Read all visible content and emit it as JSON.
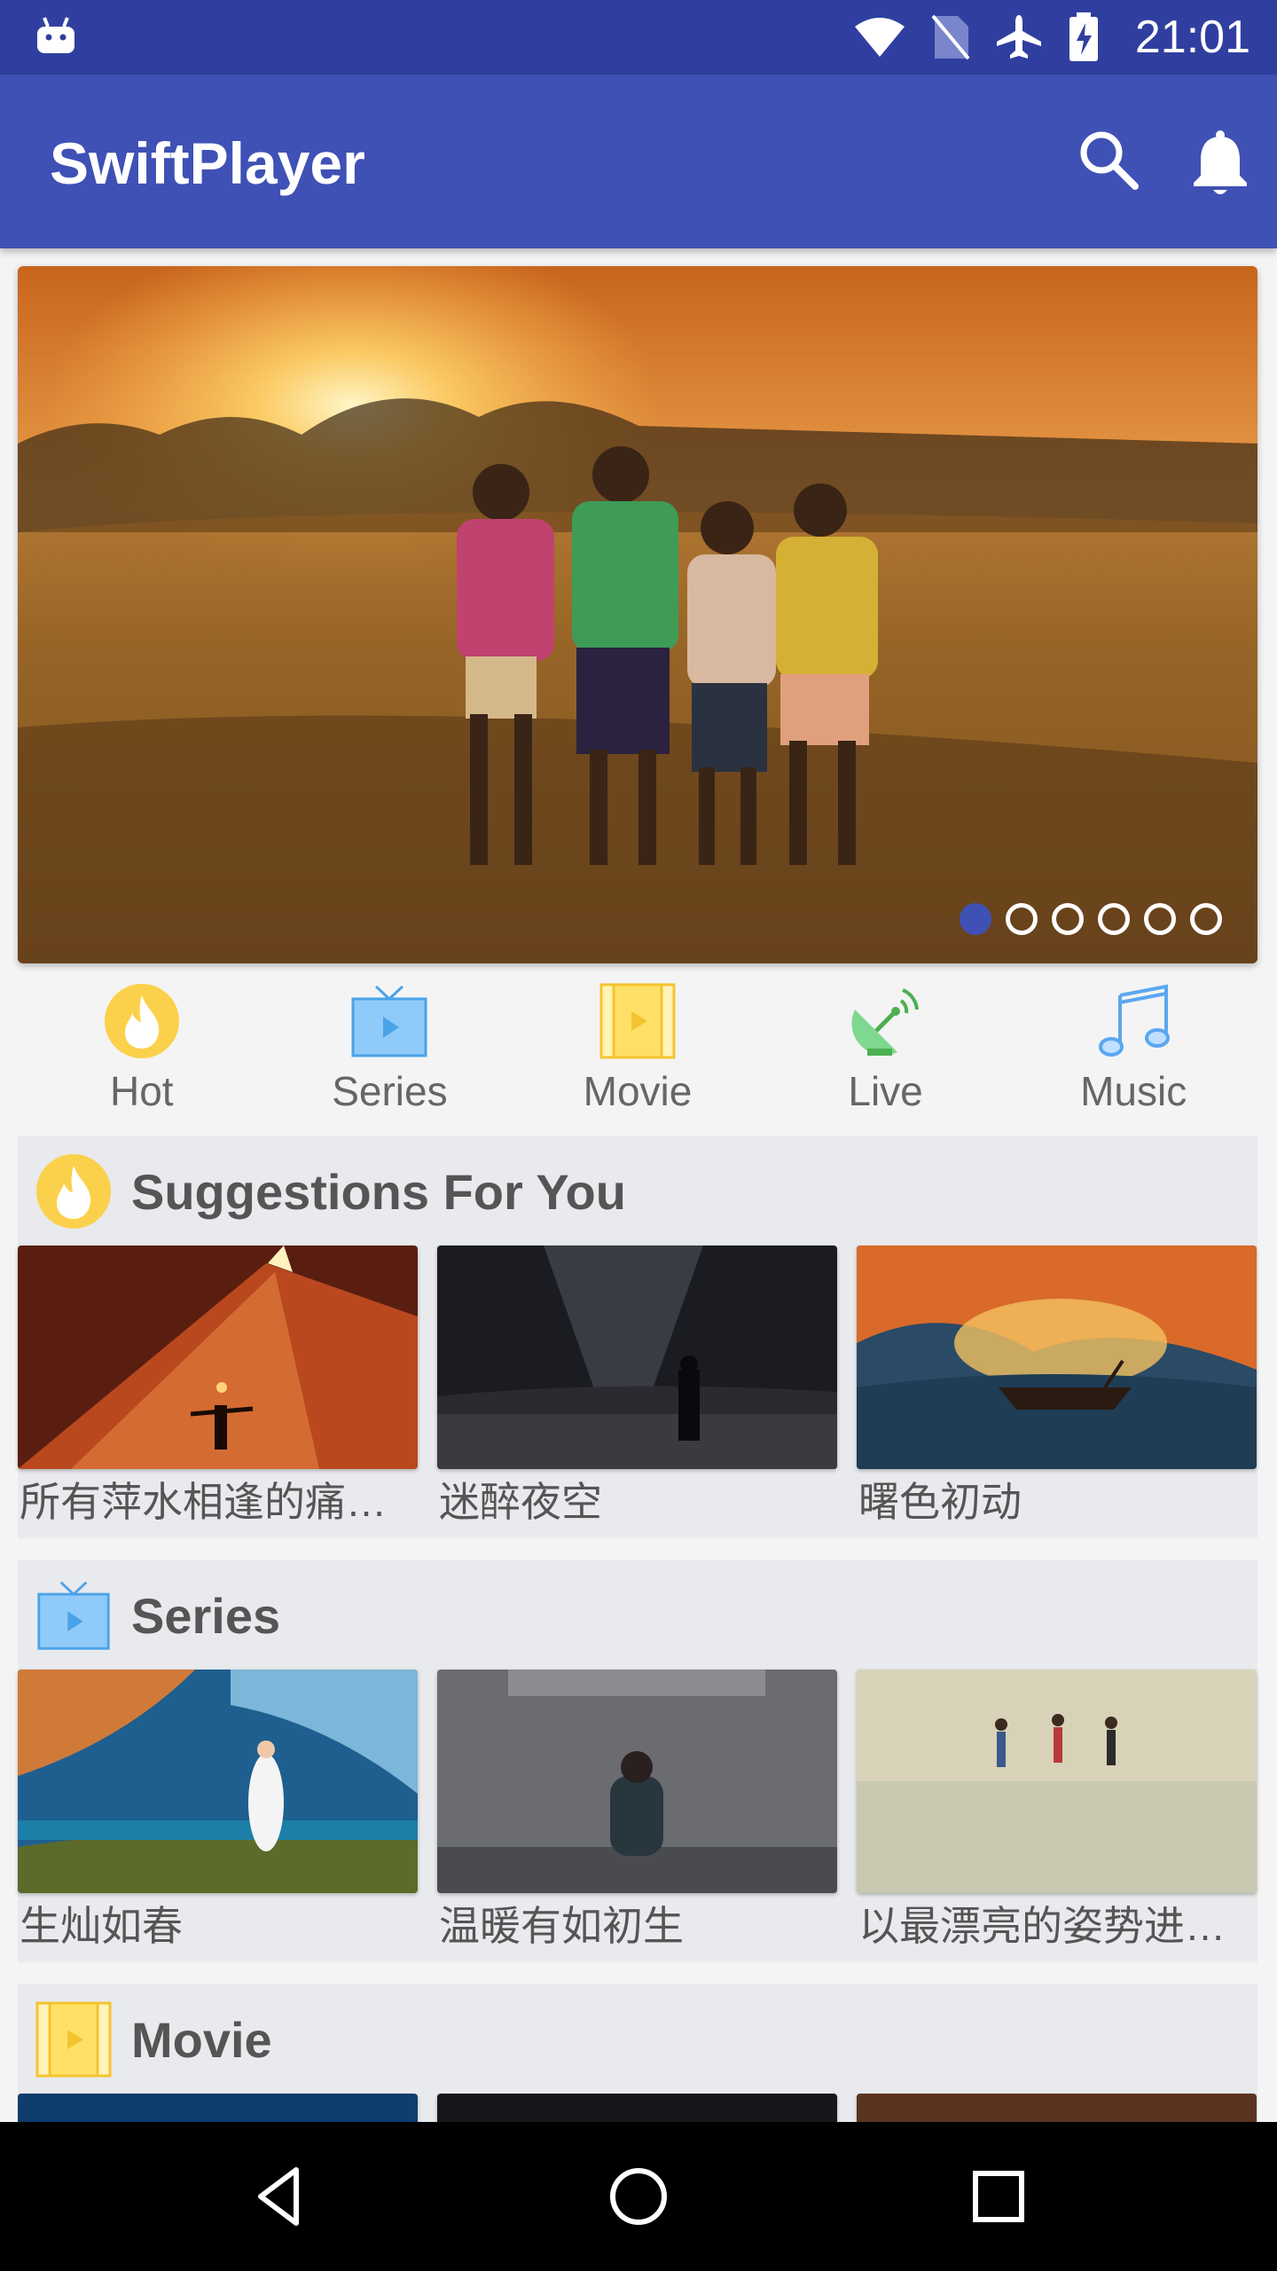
{
  "status_bar": {
    "time": "21:01",
    "icons": [
      "android-icon",
      "wifi-icon",
      "no-sim-icon",
      "airplane-icon",
      "battery-charging-icon"
    ]
  },
  "app_bar": {
    "title": "SwiftPlayer",
    "actions": [
      "search-icon",
      "bell-icon"
    ]
  },
  "banner": {
    "dot_count": 6,
    "active_dot": 0
  },
  "categories": [
    {
      "label": "Hot",
      "icon": "flame-icon"
    },
    {
      "label": "Series",
      "icon": "tv-icon"
    },
    {
      "label": "Movie",
      "icon": "film-icon"
    },
    {
      "label": "Live",
      "icon": "satellite-icon"
    },
    {
      "label": "Music",
      "icon": "music-note-icon"
    }
  ],
  "sections": [
    {
      "title": "Suggestions For You",
      "icon": "flame-icon",
      "items": [
        {
          "title": "所有萍水相逢的痛…"
        },
        {
          "title": "迷醉夜空"
        },
        {
          "title": "曙色初动"
        }
      ]
    },
    {
      "title": "Series",
      "icon": "tv-icon",
      "items": [
        {
          "title": "生灿如春"
        },
        {
          "title": "温暖有如初生"
        },
        {
          "title": "以最漂亮的姿势进…"
        }
      ]
    },
    {
      "title": "Movie",
      "icon": "film-icon",
      "items": [
        {
          "title": ""
        },
        {
          "title": ""
        },
        {
          "title": ""
        }
      ]
    }
  ],
  "colors": {
    "primary": "#3f51b5",
    "primary_dark": "#303f9f",
    "section_bg": "#e8eaed"
  }
}
